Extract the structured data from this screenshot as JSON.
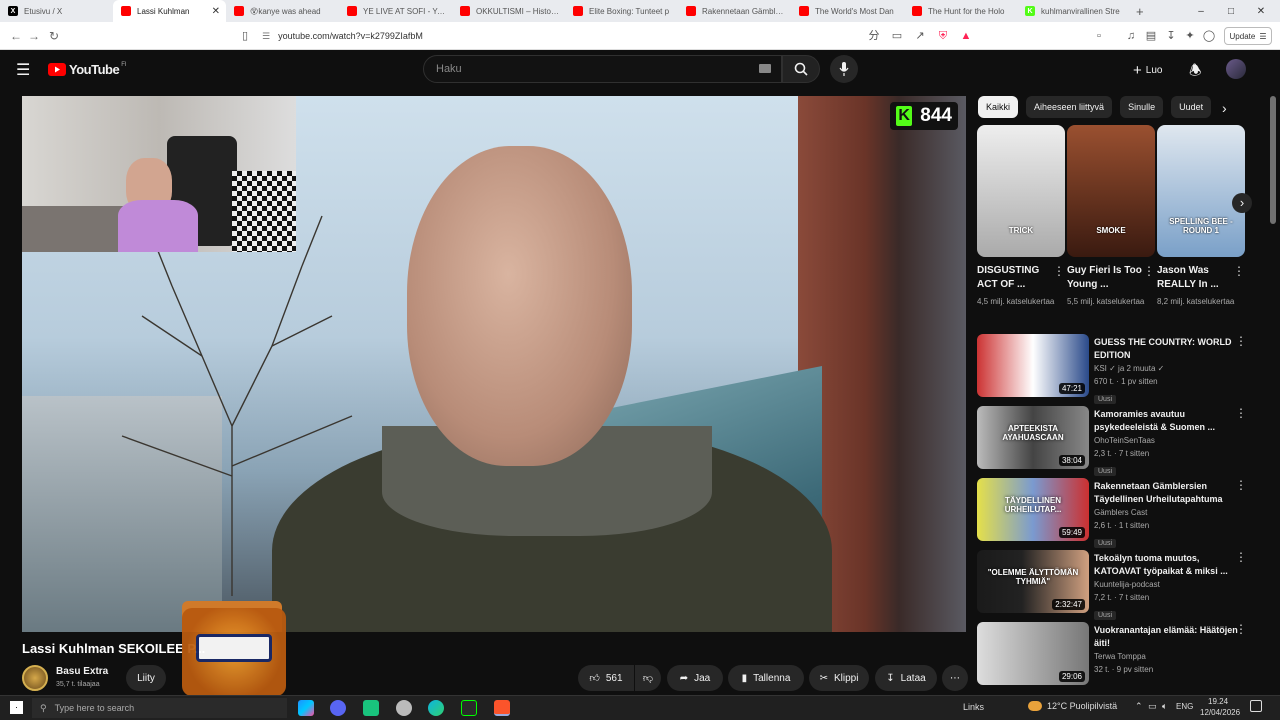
{
  "browser": {
    "tabs": [
      {
        "title": "Etusivu / X",
        "fav": "X",
        "color": "#000000",
        "active": false
      },
      {
        "title": "Lassi Kuhlman",
        "fav": "",
        "color": "#ff0000",
        "active": true
      },
      {
        "title": "😵kanye was ahead",
        "fav": "",
        "color": "#ff0000",
        "active": false
      },
      {
        "title": "YE LIVE AT SOFI - YouT",
        "fav": "",
        "color": "#ff0000",
        "active": false
      },
      {
        "title": "OKKULTISMI – Historia",
        "fav": "",
        "color": "#ff0000",
        "active": false
      },
      {
        "title": "Elite Boxing: Tunteet p",
        "fav": "",
        "color": "#ff0000",
        "active": false
      },
      {
        "title": "Rakennetaan Gämblers",
        "fav": "",
        "color": "#ff0000",
        "active": false
      },
      {
        "title": "The World's Most Dan",
        "fav": "",
        "color": "#ff0000",
        "active": false
      },
      {
        "title": "The Hunt for the Holo",
        "fav": "",
        "color": "#ff0000",
        "active": false
      },
      {
        "title": "kuhlmanvirallinen Stre",
        "fav": "K",
        "color": "#53fc18",
        "active": false
      }
    ],
    "new_tab": "+",
    "url": "youtube.com/watch?v=k2799ZIafbM",
    "update_label": "Update"
  },
  "youtube": {
    "logo_text": "YouTube",
    "region": "FI",
    "search_placeholder": "Haku",
    "create_label": "Luo",
    "kick_viewers": "844",
    "video_title": "Lassi Kuhlman SEKOILEE P...",
    "channel_name": "Basu Extra",
    "subscribers": "35,7 t. tilaajaa",
    "join_label": "Liity",
    "likes": "561",
    "share_label": "Jaa",
    "save_label": "Tallenna",
    "clip_label": "Klippi",
    "download_label": "Lataa",
    "chips": [
      "Kaikki",
      "Aiheeseen liittyvä",
      "Sinulle",
      "Uudet"
    ],
    "shorts": [
      {
        "title": "DISGUSTING ACT OF ...",
        "views": "4,5 milj. katselukertaa",
        "thumb_text": "TRICK"
      },
      {
        "title": "Guy Fieri Is Too Young ...",
        "views": "5,5 milj. katselukertaa",
        "thumb_text": "SMOKE"
      },
      {
        "title": "Jason Was REALLY In ...",
        "views": "8,2 milj. katselukertaa",
        "thumb_text": "SPELLING BEE - ROUND 1"
      }
    ],
    "videos": [
      {
        "title": "GUESS THE COUNTRY: WORLD EDITION",
        "channel": "KSI ✓ ja 2 muuta ✓",
        "meta": "670 t. · 1 pv sitten",
        "badge": "Uusi",
        "duration": "47:21"
      },
      {
        "title": "Kamoramies avautuu psykedeeleistä & Suomen ...",
        "channel": "OhoTeinSenTaas",
        "meta": "2,3 t. · 7 t sitten",
        "badge": "Uusi",
        "duration": "38:04",
        "thumb_text": "APTEEKISTA AYAHUASCAAN"
      },
      {
        "title": "Rakennetaan Gämblersien Täydellinen Urheilutapahtuma",
        "channel": "Gämblers Cast",
        "meta": "2,6 t. · 1 t sitten",
        "badge": "Uusi",
        "duration": "59:49",
        "thumb_text": "TÄYDELLINEN URHEILUTAP..."
      },
      {
        "title": "Tekoälyn tuoma muutos, KATOAVAT työpaikat & miksi ...",
        "channel": "Kuuntelija-podcast",
        "meta": "7,2 t. · 7 t sitten",
        "badge": "Uusi",
        "duration": "2:32:47",
        "thumb_text": "\"OLEMME ÄLYTTÖMÄN TYHMIÄ\""
      },
      {
        "title": "Vuokranantajan elämää: Häätöjen äiti!",
        "channel": "Terwa Tomppa",
        "meta": "32 t. · 9 pv sitten",
        "badge": "",
        "duration": "29:06"
      }
    ]
  },
  "taskbar": {
    "search_placeholder": "Type here to search",
    "links": "Links",
    "weather": "12°C Puolipilvistä",
    "lang": "ENG",
    "time": "19.24",
    "date": "12/04/2026"
  }
}
